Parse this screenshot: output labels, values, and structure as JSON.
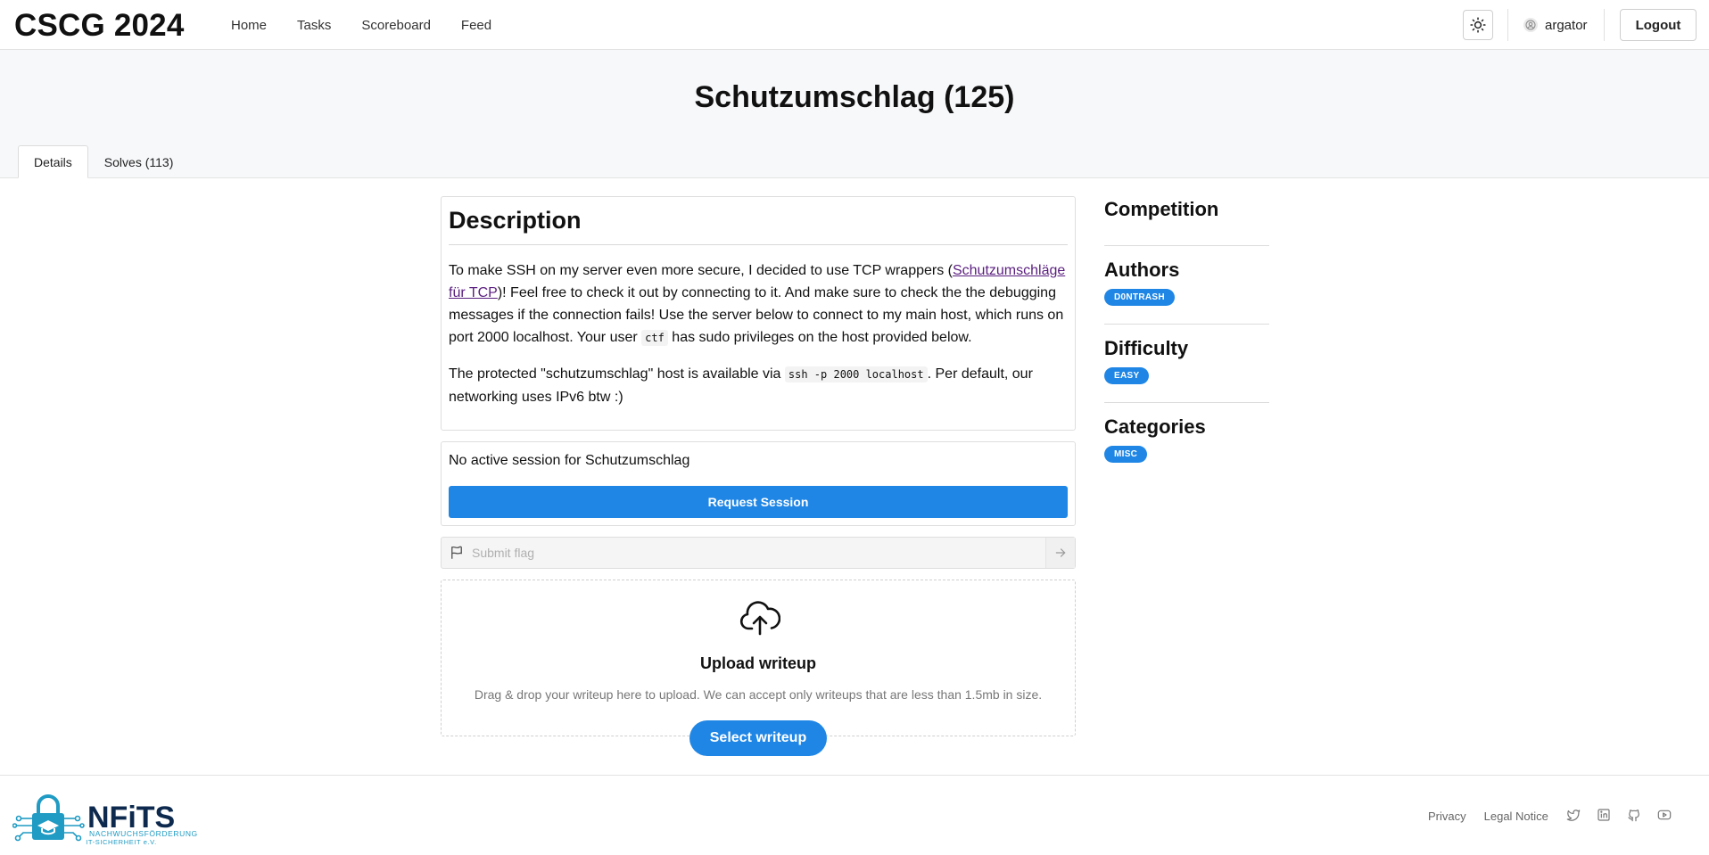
{
  "header": {
    "brand": "CSCG 2024",
    "nav": [
      "Home",
      "Tasks",
      "Scoreboard",
      "Feed"
    ],
    "username": "argator",
    "logout_label": "Logout"
  },
  "challenge": {
    "title": "Schutzumschlag (125)",
    "tabs": [
      "Details",
      "Solves (113)"
    ],
    "active_tab": "Details"
  },
  "description": {
    "heading": "Description",
    "p1_before_link": "To make SSH on my server even more secure, I decided to use TCP wrappers (",
    "link_text": "Schutzumschläge für TCP",
    "p1_after_link": ")! Feel free to check it out by connecting to it. And make sure to check the the debugging messages if the connection fails! Use the server below to connect to my main host, which runs on port 2000 localhost. Your user ",
    "p1_code": "ctf",
    "p1_end": " has sudo privileges on the host provided below.",
    "p2_before": "The protected \"schutzumschlag\" host is available via ",
    "p2_code": "ssh -p 2000 localhost",
    "p2_after": ". Per default, our networking uses IPv6 btw :)"
  },
  "session": {
    "status": "No active session for Schutzumschlag",
    "button": "Request Session"
  },
  "flag": {
    "placeholder": "Submit flag"
  },
  "upload": {
    "title": "Upload writeup",
    "hint": "Drag & drop your writeup here to upload. We can accept only writeups that are less than 1.5mb in size.",
    "button": "Select writeup"
  },
  "sidebar": {
    "competition_heading": "Competition",
    "authors_heading": "Authors",
    "authors": [
      "D0NTRASH"
    ],
    "difficulty_heading": "Difficulty",
    "difficulty": "EASY",
    "categories_heading": "Categories",
    "categories": [
      "MISC"
    ]
  },
  "footer": {
    "logo_name": "NFiTS",
    "logo_sub1": "NACHWUCHSFÖRDERUNG",
    "logo_sub2": "IT-SICHERHEIT e.V.",
    "links": [
      "Privacy",
      "Legal Notice"
    ],
    "social_icons": [
      "twitter-icon",
      "linkedin-icon",
      "github-icon",
      "youtube-icon"
    ]
  },
  "colors": {
    "accent": "#1f86e5",
    "link": "#5a1e7f",
    "logo_dark": "#0d2a4e",
    "logo_teal": "#1f9bc4"
  }
}
